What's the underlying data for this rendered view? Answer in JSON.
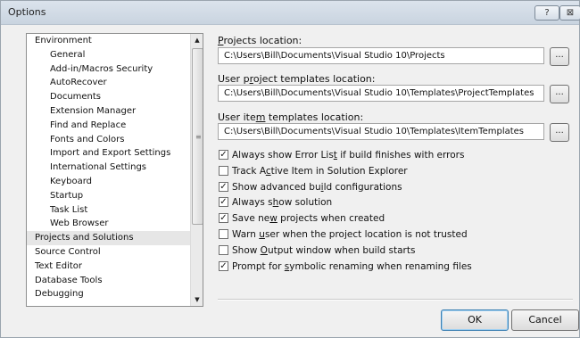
{
  "window": {
    "title": "Options"
  },
  "caption_buttons": {
    "help": "?",
    "close": "⊠"
  },
  "tree": {
    "items": [
      {
        "label": "Environment",
        "level": 0
      },
      {
        "label": "General",
        "level": 1
      },
      {
        "label": "Add-in/Macros Security",
        "level": 1
      },
      {
        "label": "AutoRecover",
        "level": 1
      },
      {
        "label": "Documents",
        "level": 1
      },
      {
        "label": "Extension Manager",
        "level": 1
      },
      {
        "label": "Find and Replace",
        "level": 1
      },
      {
        "label": "Fonts and Colors",
        "level": 1
      },
      {
        "label": "Import and Export Settings",
        "level": 1
      },
      {
        "label": "International Settings",
        "level": 1
      },
      {
        "label": "Keyboard",
        "level": 1
      },
      {
        "label": "Startup",
        "level": 1
      },
      {
        "label": "Task List",
        "level": 1
      },
      {
        "label": "Web Browser",
        "level": 1
      },
      {
        "label": "Projects and Solutions",
        "level": 0,
        "selected": true
      },
      {
        "label": "Source Control",
        "level": 0
      },
      {
        "label": "Text Editor",
        "level": 0
      },
      {
        "label": "Database Tools",
        "level": 0
      },
      {
        "label": "Debugging",
        "level": 0
      }
    ]
  },
  "projects_location": {
    "label_pre": "",
    "label_ul": "P",
    "label_post": "rojects location:",
    "value": "C:\\Users\\Bill\\Documents\\Visual Studio 10\\Projects"
  },
  "user_project_templates": {
    "label_pre": "User p",
    "label_ul": "r",
    "label_post": "oject templates location:",
    "value": "C:\\Users\\Bill\\Documents\\Visual Studio 10\\Templates\\ProjectTemplates"
  },
  "user_item_templates": {
    "label_pre": "User ite",
    "label_ul": "m",
    "label_post": " templates location:",
    "value": "C:\\Users\\Bill\\Documents\\Visual Studio 10\\Templates\\ItemTemplates"
  },
  "browse_label": "...",
  "checkboxes": [
    {
      "pre": "Always show Error Lis",
      "ul": "t",
      "post": " if build finishes with errors",
      "checked": true
    },
    {
      "pre": "Track A",
      "ul": "c",
      "post": "tive Item in Solution Explorer",
      "checked": false
    },
    {
      "pre": "Show advanced bu",
      "ul": "i",
      "post": "ld configurations",
      "checked": true
    },
    {
      "pre": "Always s",
      "ul": "h",
      "post": "ow solution",
      "checked": true
    },
    {
      "pre": "Save ne",
      "ul": "w",
      "post": " projects when created",
      "checked": true
    },
    {
      "pre": "Warn ",
      "ul": "u",
      "post": "ser when the project location is not trusted",
      "checked": false
    },
    {
      "pre": "Show ",
      "ul": "O",
      "post": "utput window when build starts",
      "checked": false
    },
    {
      "pre": "Prompt for ",
      "ul": "s",
      "post": "ymbolic renaming when renaming files",
      "checked": true
    }
  ],
  "buttons": {
    "ok": "OK",
    "cancel": "Cancel"
  },
  "check_mark": "✓"
}
